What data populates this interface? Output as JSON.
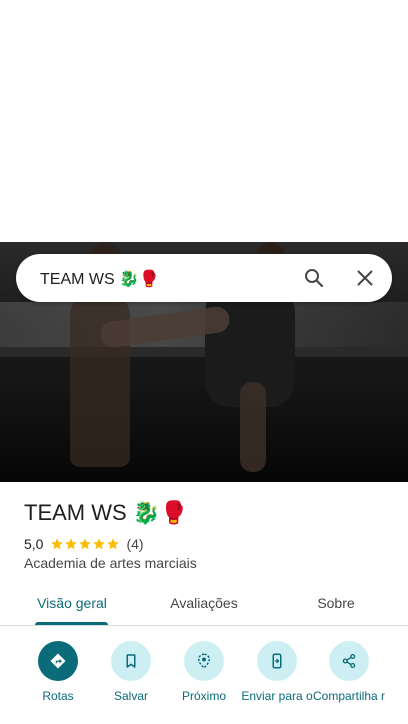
{
  "search": {
    "query": "TEAM WS 🐉🥊"
  },
  "place": {
    "name": "TEAM WS 🐉🥊",
    "rating": "5,0",
    "stars": 5,
    "review_count": "(4)",
    "category": "Academia de artes marciais"
  },
  "tabs": [
    {
      "label": "Visão geral",
      "active": true
    },
    {
      "label": "Avaliações",
      "active": false
    },
    {
      "label": "Sobre",
      "active": false
    }
  ],
  "actions": [
    {
      "label": "Rotas",
      "icon": "directions-icon"
    },
    {
      "label": "Salvar",
      "icon": "bookmark-icon"
    },
    {
      "label": "Próximo",
      "icon": "nearby-icon"
    },
    {
      "label": "Enviar para o",
      "icon": "send-to-phone-icon"
    },
    {
      "label": "Compartilha r",
      "icon": "share-icon"
    }
  ],
  "colors": {
    "accent": "#0b6b79",
    "accent_light": "#cdeff4",
    "star": "#fbbc04"
  }
}
